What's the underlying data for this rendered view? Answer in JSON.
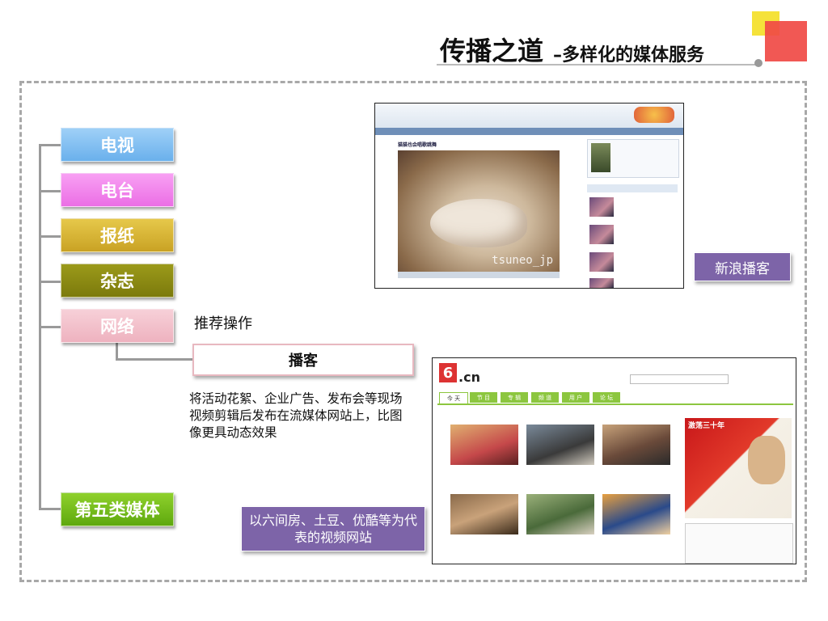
{
  "header": {
    "title": "传播之道",
    "subtitle": "–多样化的媒体服务"
  },
  "categories": [
    {
      "label": "电视"
    },
    {
      "label": "电台"
    },
    {
      "label": "报纸"
    },
    {
      "label": "杂志"
    },
    {
      "label": "网络"
    },
    {
      "label": "第五类媒体"
    }
  ],
  "recommend_label": "推荐操作",
  "boke_label": "播客",
  "description": "将活动花絮、企业广告、发布会等现场视频剪辑后发布在流媒体网站上，比图像更具动态效果",
  "sina_label": "新浪播客",
  "liu_label": "以六间房、土豆、优酷等为代表的视频网站",
  "colors": {
    "accent_red": "#f04a45",
    "accent_yellow": "#f5e23a",
    "purple": "#7d64a8",
    "green": "#8cc63f"
  },
  "shot_sina": {
    "video_title": "猫猫也会唱歌跳舞",
    "watermark": "tsuneo_jp"
  },
  "shot_6cn": {
    "logo_num": "6",
    "logo_text": ".cn",
    "tabs": [
      "今 天",
      "节 目",
      "专 辑",
      "频 道",
      "用 户",
      "论 坛"
    ],
    "promo_title": "激荡三十年"
  }
}
